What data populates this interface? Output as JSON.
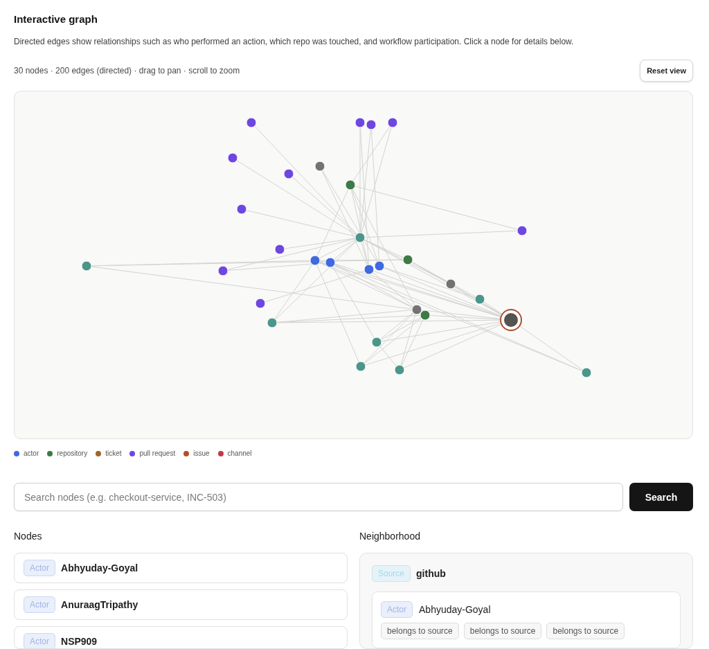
{
  "header": {
    "title": "Interactive graph",
    "description": "Directed edges show relationships such as who performed an action, which repo was touched, and workflow participation. Click a node for details below.",
    "stats": "30 nodes · 200 edges (directed) · drag to pan · scroll to zoom",
    "reset_button": "Reset view"
  },
  "graph": {
    "nodes": [
      {
        "color": "#6f46e0",
        "selected": false
      },
      {
        "color": "#6f46e0",
        "selected": false
      },
      {
        "color": "#6f46e0",
        "selected": false
      },
      {
        "color": "#6f46e0",
        "selected": false
      },
      {
        "color": "#6f46e0",
        "selected": false
      },
      {
        "color": "#737373",
        "selected": false
      },
      {
        "color": "#6f46e0",
        "selected": false
      },
      {
        "color": "#3d7a45",
        "selected": false
      },
      {
        "color": "#6f46e0",
        "selected": false
      },
      {
        "color": "#6f46e0",
        "selected": false
      },
      {
        "color": "#4b958a",
        "selected": false
      },
      {
        "color": "#6f46e0",
        "selected": false
      },
      {
        "color": "#4b958a",
        "selected": false
      },
      {
        "color": "#4068e0",
        "selected": false
      },
      {
        "color": "#4068e0",
        "selected": false
      },
      {
        "color": "#3d7a45",
        "selected": false
      },
      {
        "color": "#6f46e0",
        "selected": false
      },
      {
        "color": "#4068e0",
        "selected": false
      },
      {
        "color": "#4068e0",
        "selected": false
      },
      {
        "color": "#737373",
        "selected": false
      },
      {
        "color": "#4b958a",
        "selected": false
      },
      {
        "color": "#6f46e0",
        "selected": false
      },
      {
        "color": "#737373",
        "selected": false
      },
      {
        "color": "#55524f",
        "selected": true
      },
      {
        "color": "#3d7a45",
        "selected": false
      },
      {
        "color": "#4b958a",
        "selected": false
      },
      {
        "color": "#4b958a",
        "selected": false
      },
      {
        "color": "#4b958a",
        "selected": false
      },
      {
        "color": "#4b958a",
        "selected": false
      },
      {
        "color": "#4b958a",
        "selected": false
      }
    ]
  },
  "legend": [
    {
      "label": "actor",
      "color": "#4068e0"
    },
    {
      "label": "repository",
      "color": "#3d7a45"
    },
    {
      "label": "ticket",
      "color": "#a0652a"
    },
    {
      "label": "pull request",
      "color": "#6f46e0"
    },
    {
      "label": "issue",
      "color": "#b0502c"
    },
    {
      "label": "channel",
      "color": "#c23a4a"
    }
  ],
  "search": {
    "placeholder": "Search nodes (e.g. checkout-service, INC-503)",
    "button": "Search"
  },
  "nodes_panel": {
    "title": "Nodes",
    "items": [
      {
        "kind": "actor",
        "type": "Actor",
        "name": "Abhyuday-Goyal"
      },
      {
        "kind": "actor",
        "type": "Actor",
        "name": "AnuraagTripathy"
      },
      {
        "kind": "actor",
        "type": "Actor",
        "name": "NSP909"
      }
    ]
  },
  "neighborhood": {
    "title": "Neighborhood",
    "source": {
      "kind": "source",
      "type": "Source",
      "name": "github"
    },
    "neighbors": [
      {
        "kind": "actor",
        "type": "Actor",
        "name": "Abhyuday-Goyal",
        "relations": [
          "belongs to source",
          "belongs to source",
          "belongs to source"
        ]
      }
    ]
  }
}
